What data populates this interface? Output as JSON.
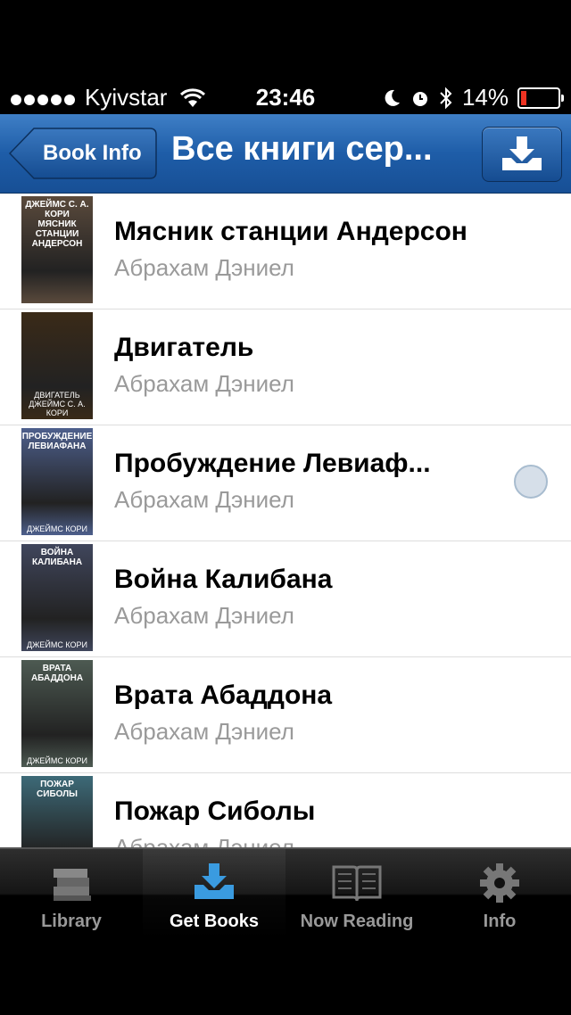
{
  "status_bar": {
    "carrier": "Kyivstar",
    "time": "23:46",
    "battery": "14%"
  },
  "navbar": {
    "back_label": "Book Info",
    "title": "Все книги сер..."
  },
  "books": [
    {
      "title": "Мясник станции Андерсон",
      "author": "Абрахам Дэниел",
      "cover_top": "ДЖЕЙМС С. А. КОРИ\nМЯСНИК СТАНЦИИ\nАНДЕРСОН",
      "cover_bottom": "",
      "cover_color": "#5a4a3c"
    },
    {
      "title": "Двигатель",
      "author": "Абрахам Дэниел",
      "cover_top": "",
      "cover_bottom": "ДВИГАТЕЛЬ\nДЖЕЙМС С. А. КОРИ",
      "cover_color": "#3a2a18"
    },
    {
      "title": "Пробуждение Левиаф...",
      "author": "Абрахам Дэниел",
      "cover_top": "ПРОБУЖДЕНИЕ\nЛЕВИАФАНА",
      "cover_bottom": "ДЖЕЙМС КОРИ",
      "cover_color": "#4d5f8c"
    },
    {
      "title": "Война Калибана",
      "author": "Абрахам Дэниел",
      "cover_top": "ВОЙНА\nКАЛИБАНА",
      "cover_bottom": "ДЖЕЙМС КОРИ",
      "cover_color": "#40465c"
    },
    {
      "title": "Врата Абаддона",
      "author": "Абрахам Дэниел",
      "cover_top": "ВРАТА\nАБАДДОНА",
      "cover_bottom": "ДЖЕЙМС КОРИ",
      "cover_color": "#4d5a52"
    },
    {
      "title": "Пожар Сиболы",
      "author": "Абрахам Дэниел",
      "cover_top": "ПОЖАР\nСИБОЛЫ",
      "cover_bottom": "",
      "cover_color": "#3d6a78"
    }
  ],
  "tabs": [
    {
      "label": "Library",
      "icon": "books-stack-icon"
    },
    {
      "label": "Get Books",
      "icon": "download-tray-icon"
    },
    {
      "label": "Now Reading",
      "icon": "open-book-icon"
    },
    {
      "label": "Info",
      "icon": "gear-icon"
    }
  ],
  "colors": {
    "nav_blue": "#1e5da8",
    "active_tab_icon": "#3a9be0",
    "author_gray": "#9a9a9a"
  }
}
